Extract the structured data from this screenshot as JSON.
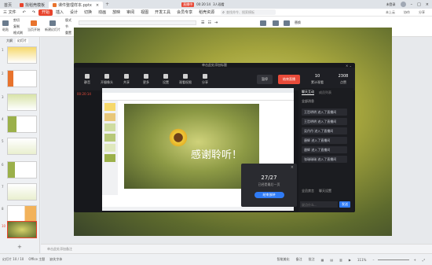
{
  "titlebar": {
    "tabs": [
      {
        "label": "首页"
      },
      {
        "label": "找稻壳模板"
      },
      {
        "label": "课件整理样本.pptx"
      }
    ],
    "live_badge": "直播中",
    "live_time": "00:20:14",
    "viewers_label": "3人观看",
    "user_label": "未登录"
  },
  "menubar": {
    "file": "三 文件",
    "items": [
      "开始",
      "插入",
      "设计",
      "切换",
      "动画",
      "放映",
      "审阅",
      "视图",
      "开发工具",
      "会员专享",
      "稻壳资源"
    ],
    "search_placeholder": "查找命令、搜索模板",
    "right": [
      "未上云",
      "协作",
      "分享"
    ]
  },
  "ribbon": {
    "groups": [
      "粘贴",
      "剪切",
      "复制",
      "格式刷",
      "当页开始",
      "新建幻灯片",
      "版式",
      "节",
      "重置",
      "文本框",
      "形状",
      "排列",
      "替换",
      "选择"
    ]
  },
  "leftpanel": {
    "tabs": [
      "大纲",
      "幻灯片"
    ],
    "slide_numbers": [
      "1",
      "2",
      "3",
      "4",
      "5",
      "6",
      "7",
      "8",
      "9",
      "10"
    ]
  },
  "live": {
    "window_title": "单击此处添加标题",
    "tools": [
      "静音",
      "开摄像头",
      "共享",
      "更多",
      "设置",
      "观看权限",
      "分享"
    ],
    "pause_label": "暂停",
    "end_label": "结束直播",
    "stats": [
      {
        "value": "10",
        "label": "累计观看"
      },
      {
        "value": "2308",
        "label": "点赞"
      }
    ],
    "time": "00:20:14",
    "chat_tabs": [
      "聊天互动",
      "成员列表"
    ],
    "chat_filter": "全部消息",
    "messages": [
      "王哲明明 进入了直播间",
      "王哲明明 进入了直播间",
      "吴丹丹 进入了直播间",
      "唐辉 进入了直播间",
      "唐辉 进入了直播间",
      "张瑞瑞瑞 进入了直播间"
    ],
    "chat_placeholder": "说点什么...",
    "send_label": "发送",
    "all_mute": "全员禁言",
    "chat_settings": "聊天设置",
    "popup_counter": "27/27",
    "popup_sub": "已经是最后一页",
    "popup_button": "结束放映",
    "slide_text": "感谢聆听！"
  },
  "notes": {
    "placeholder": "单击此处添加备注"
  },
  "status": {
    "slide_info": "幻灯片 10 / 10",
    "theme": "Office 主题",
    "font_missing": "缺失字体",
    "smart_beautify": "智能美化",
    "remarks": "备注",
    "comments": "批注",
    "zoom": "111%"
  },
  "colors": {
    "accent": "#e8442d",
    "brand_blue": "#2f7bf5",
    "live_red": "#e84b3a"
  }
}
